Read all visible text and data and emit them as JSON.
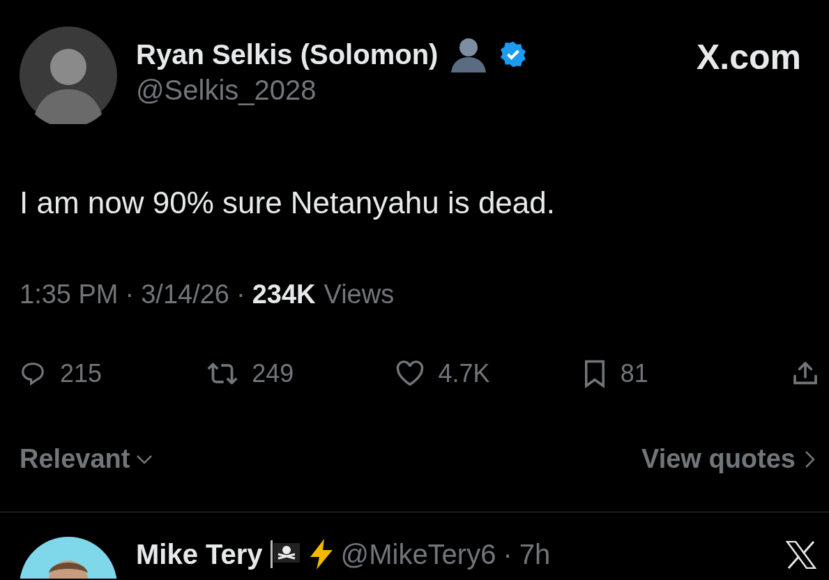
{
  "post": {
    "author": {
      "name": "Ryan Selkis (Solomon)",
      "handle": "@Selkis_2028",
      "verified": true
    },
    "source_label": "X.com",
    "text": "I am now 90% sure Netanyahu is dead.",
    "time": "1:35 PM",
    "separator_1": "·",
    "date": "3/14/26",
    "separator_2": "·",
    "views_count": "234K",
    "views_label": "Views",
    "actions": [
      {
        "kind": "reply",
        "count": "215"
      },
      {
        "kind": "repost",
        "count": "249"
      },
      {
        "kind": "like",
        "count": "4.7K"
      },
      {
        "kind": "bookmark",
        "count": "81"
      },
      {
        "kind": "share"
      }
    ]
  },
  "sort": {
    "label": "Relevant",
    "link": "View quotes"
  },
  "reply": {
    "name": "Mike Tery",
    "handle": "@MikeTery6",
    "separator": "·",
    "age": "7h"
  }
}
